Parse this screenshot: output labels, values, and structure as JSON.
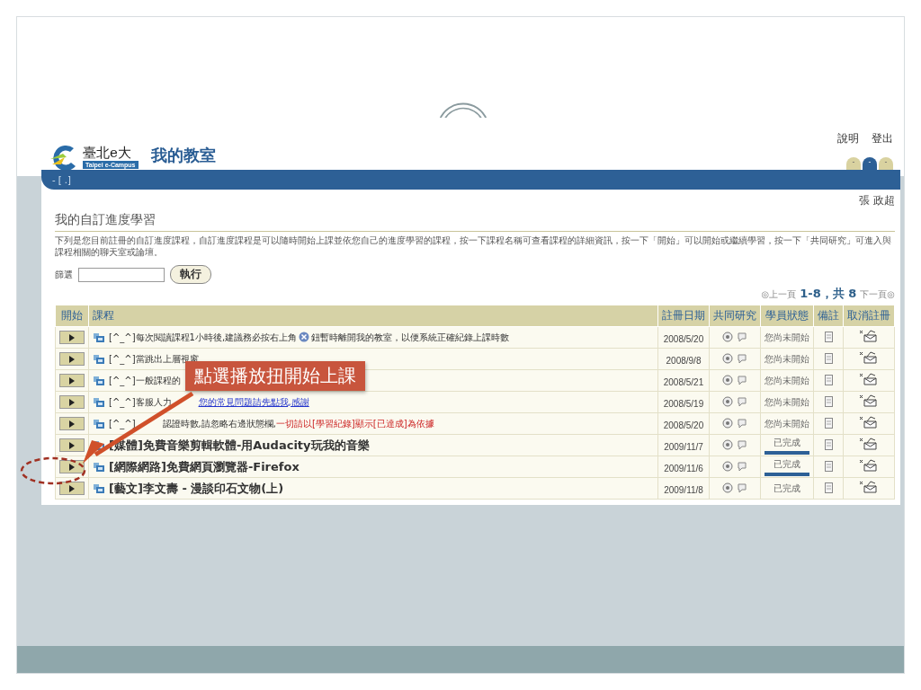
{
  "header": {
    "logo_name": "臺北e大",
    "logo_tagline": "Taipei e-Campus",
    "title": "我的教室",
    "links": [
      "說明",
      "登出"
    ]
  },
  "tabs": [
    {
      "label": "-",
      "selected": false
    },
    {
      "label": "-",
      "selected": true
    },
    {
      "label": "-",
      "selected": false
    }
  ],
  "nav_marks": "- [ .]",
  "user": "張 政超",
  "page_title": "我的自訂進度學習",
  "description": "下列是您目前註冊的自訂進度課程，自訂進度課程是可以隨時開始上課並依您自己的進度學習的課程，按一下課程名稱可查看課程的詳細資訊，按一下「開始」可以開始或繼續學習，按一下「共同研究」可進入與課程相關的聊天室或論壇。",
  "filter": {
    "label": "篩選",
    "button": "執行"
  },
  "pagination": {
    "prev": "◎上一頁",
    "summary": "1-8，共 8",
    "next": "下一頁◎"
  },
  "table": {
    "columns": [
      "開始",
      "課程",
      "註冊日期",
      "共同研究",
      "學員狀態",
      "備註",
      "取消註冊"
    ],
    "rows": [
      {
        "kind": "notice",
        "segments": [
          {
            "kind": "plain",
            "text": "[^_^]每次閱讀課程1小時後,建議務必按右上角"
          },
          {
            "kind": "close-icon"
          },
          {
            "kind": "plain",
            "text": "鈕暫時離開我的教室，以便系統正確紀錄上課時數"
          }
        ],
        "date": "2008/5/20",
        "status": "您尚未開始"
      },
      {
        "kind": "notice",
        "segments": [
          {
            "kind": "plain",
            "text": "[^_^]當跳出上層視窗"
          }
        ],
        "date": "2008/9/8",
        "status": "您尚未開始"
      },
      {
        "kind": "notice",
        "segments": [
          {
            "kind": "plain",
            "text": "[^_^]一般課程的"
          }
        ],
        "date": "2008/5/21",
        "status": "您尚未開始"
      },
      {
        "kind": "notice",
        "segments": [
          {
            "kind": "plain",
            "text": "[^_^]客服人力"
          },
          {
            "kind": "covered"
          },
          {
            "kind": "link",
            "text": "您的常見問題請先點我,感謝"
          }
        ],
        "date": "2008/5/19",
        "status": "您尚未開始"
      },
      {
        "kind": "notice",
        "segments": [
          {
            "kind": "plain",
            "text": "[^_^]"
          },
          {
            "kind": "covered"
          },
          {
            "kind": "plain",
            "text": "認證時數,請忽略右邊狀態欄,"
          },
          {
            "kind": "alert",
            "text": "一切請以[學習紀錄]顯示[已達成]為依據"
          }
        ],
        "date": "2008/5/20",
        "status": "您尚未開始"
      },
      {
        "kind": "course",
        "segments": [
          {
            "kind": "plain",
            "text": "[媒體]免費音樂剪輯軟體-用Audacity玩我的音樂"
          }
        ],
        "date": "2009/11/7",
        "status": "已完成",
        "level": 1
      },
      {
        "kind": "course",
        "segments": [
          {
            "kind": "plain",
            "text": "[網際網路]免費網頁瀏覽器-Firefox"
          }
        ],
        "date": "2009/11/6",
        "status": "已完成",
        "level": 1
      },
      {
        "kind": "course",
        "segments": [
          {
            "kind": "plain",
            "text": "[藝文]李文壽 - 漫談印石文物(上)"
          }
        ],
        "date": "2009/11/8",
        "status": "已完成"
      }
    ]
  },
  "callout": "點選播放扭開始上課"
}
